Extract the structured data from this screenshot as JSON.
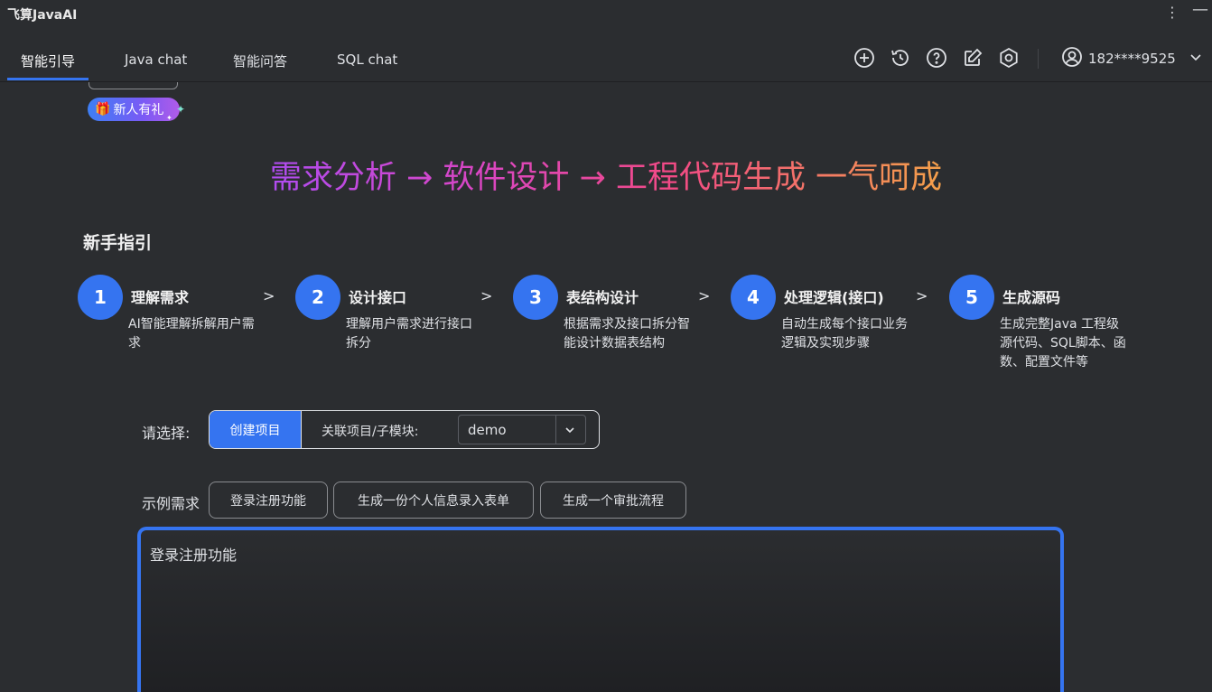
{
  "app": {
    "title": "飞算JavaAI",
    "menu_icon": "kebab-menu-icon",
    "minimize_icon": "minimize-icon"
  },
  "tabs": [
    {
      "label": "智能引导",
      "active": true
    },
    {
      "label": "Java chat",
      "active": false
    },
    {
      "label": "智能问答",
      "active": false
    },
    {
      "label": "SQL chat",
      "active": false
    }
  ],
  "toolbar_icons": [
    "plus-circle-icon",
    "history-icon",
    "help-icon",
    "edit-icon",
    "settings-icon"
  ],
  "user": {
    "name": "182****9525",
    "icon": "user-icon"
  },
  "gift_badge": {
    "label": "新人有礼",
    "icon": "🎁"
  },
  "headline": "需求分析 → 软件设计 → 工程代码生成 一气呵成",
  "guide": {
    "title": "新手指引",
    "arrow": ">",
    "steps": [
      {
        "num": "1",
        "title": "理解需求",
        "desc": "AI智能理解拆解用户需求"
      },
      {
        "num": "2",
        "title": "设计接口",
        "desc": "理解用户需求进行接口拆分"
      },
      {
        "num": "3",
        "title": "表结构设计",
        "desc": "根据需求及接口拆分智能设计数据表结构"
      },
      {
        "num": "4",
        "title": "处理逻辑(接口)",
        "desc": "自动生成每个接口业务逻辑及实现步骤"
      },
      {
        "num": "5",
        "title": "生成源码",
        "desc": "生成完整Java 工程级源代码、SQL脚本、函数、配置文件等"
      }
    ]
  },
  "selection": {
    "label": "请选择:",
    "create_button": "创建项目",
    "assoc_label": "关联项目/子模块:",
    "dropdown_value": "demo"
  },
  "examples": {
    "label": "示例需求",
    "chips": [
      "登录注册功能",
      "生成一份个人信息录入表单",
      "生成一个审批流程"
    ]
  },
  "requirement": {
    "value": "登录注册功能"
  },
  "colors": {
    "accent": "#3574f0",
    "background": "#2b2d30"
  }
}
